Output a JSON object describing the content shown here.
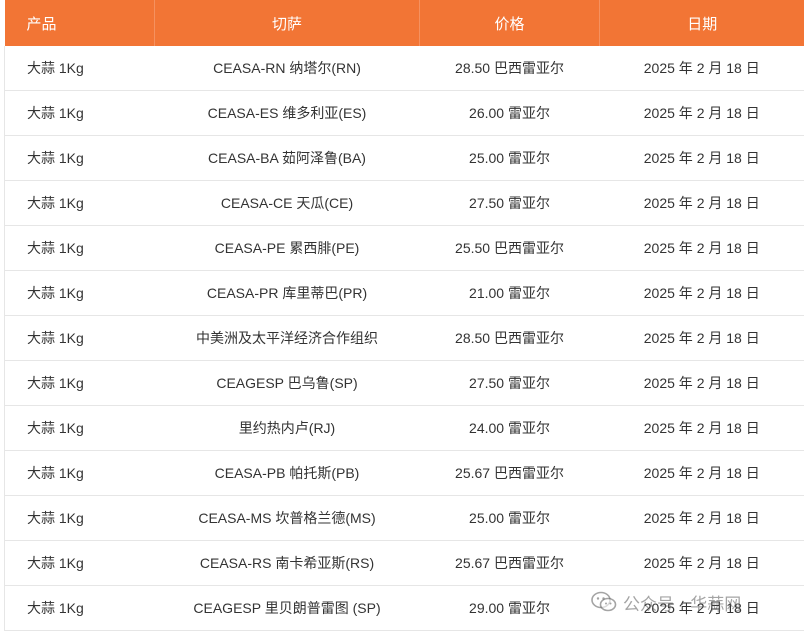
{
  "table": {
    "headers": [
      "产品",
      "切萨",
      "价格",
      "日期"
    ],
    "rows": [
      [
        "大蒜 1Kg",
        "CEASA-RN 纳塔尔(RN)",
        "28.50 巴西雷亚尔",
        "2025 年 2 月 18 日"
      ],
      [
        "大蒜 1Kg",
        "CEASA-ES 维多利亚(ES)",
        "26.00 雷亚尔",
        "2025 年 2 月 18 日"
      ],
      [
        "大蒜 1Kg",
        "CEASA-BA 茹阿泽鲁(BA)",
        "25.00 雷亚尔",
        "2025 年 2 月 18 日"
      ],
      [
        "大蒜 1Kg",
        "CEASA-CE 天瓜(CE)",
        "27.50 雷亚尔",
        "2025 年 2 月 18 日"
      ],
      [
        "大蒜 1Kg",
        "CEASA-PE 累西腓(PE)",
        "25.50 巴西雷亚尔",
        "2025 年 2 月 18 日"
      ],
      [
        "大蒜 1Kg",
        "CEASA-PR 库里蒂巴(PR)",
        "21.00 雷亚尔",
        "2025 年 2 月 18 日"
      ],
      [
        "大蒜 1Kg",
        "中美洲及太平洋经济合作组织",
        "28.50 巴西雷亚尔",
        "2025 年 2 月 18 日"
      ],
      [
        "大蒜 1Kg",
        "CEAGESP 巴乌鲁(SP)",
        "27.50 雷亚尔",
        "2025 年 2 月 18 日"
      ],
      [
        "大蒜 1Kg",
        "里约热内卢(RJ)",
        "24.00 雷亚尔",
        "2025 年 2 月 18 日"
      ],
      [
        "大蒜 1Kg",
        "CEASA-PB 帕托斯(PB)",
        "25.67 巴西雷亚尔",
        "2025 年 2 月 18 日"
      ],
      [
        "大蒜 1Kg",
        "CEASA-MS 坎普格兰德(MS)",
        "25.00 雷亚尔",
        "2025 年 2 月 18 日"
      ],
      [
        "大蒜 1Kg",
        "CEASA-RS 南卡希亚斯(RS)",
        "25.67 巴西雷亚尔",
        "2025 年 2 月 18 日"
      ],
      [
        "大蒜 1Kg",
        "CEAGESP 里贝朗普雷图 (SP)",
        "29.00 雷亚尔",
        "2025 年 2 月 18 日"
      ]
    ]
  },
  "watermark": {
    "text": "公众号 · 华蒜网",
    "icon": "wechat-icon"
  },
  "colors": {
    "header_bg": "#f27535",
    "header_text": "#ffffff",
    "row_border": "#e6e6e6",
    "cell_text": "#333333"
  }
}
